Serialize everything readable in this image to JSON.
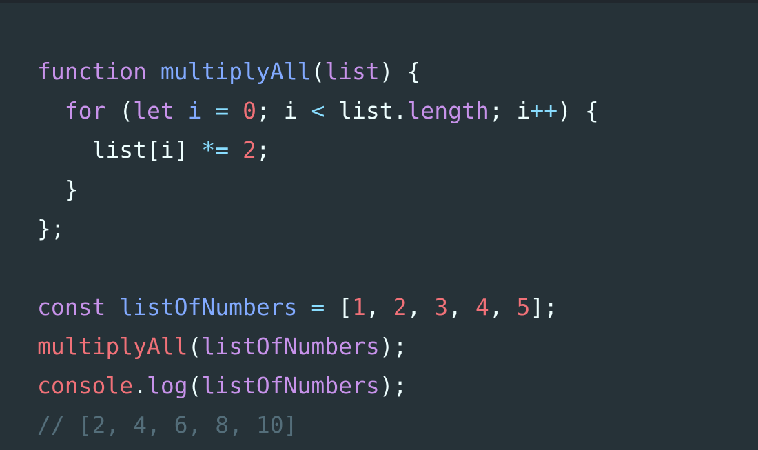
{
  "colors": {
    "background": "#263238",
    "default": "#eeffff",
    "keyword": "#c792ea",
    "function": "#82aaff",
    "number": "#f07178",
    "operator": "#89ddff",
    "comment": "#546e7a",
    "call": "#f07178",
    "punctuation": "#eeffff"
  },
  "code": {
    "lines": [
      {
        "tokens": [
          {
            "text": "function",
            "type": "keyword"
          },
          {
            "text": " ",
            "type": "default"
          },
          {
            "text": "multiplyAll",
            "type": "function"
          },
          {
            "text": "(",
            "type": "punctuation"
          },
          {
            "text": "list",
            "type": "keyword"
          },
          {
            "text": ") {",
            "type": "punctuation"
          }
        ]
      },
      {
        "tokens": [
          {
            "text": "  ",
            "type": "default"
          },
          {
            "text": "for",
            "type": "keyword"
          },
          {
            "text": " (",
            "type": "punctuation"
          },
          {
            "text": "let",
            "type": "keyword"
          },
          {
            "text": " ",
            "type": "default"
          },
          {
            "text": "i",
            "type": "function"
          },
          {
            "text": " ",
            "type": "default"
          },
          {
            "text": "=",
            "type": "operator"
          },
          {
            "text": " ",
            "type": "default"
          },
          {
            "text": "0",
            "type": "number"
          },
          {
            "text": "; i ",
            "type": "default"
          },
          {
            "text": "<",
            "type": "operator"
          },
          {
            "text": " list.",
            "type": "default"
          },
          {
            "text": "length",
            "type": "keyword"
          },
          {
            "text": "; i",
            "type": "default"
          },
          {
            "text": "++",
            "type": "operator"
          },
          {
            "text": ") {",
            "type": "punctuation"
          }
        ]
      },
      {
        "tokens": [
          {
            "text": "    list[i] ",
            "type": "default"
          },
          {
            "text": "*=",
            "type": "operator"
          },
          {
            "text": " ",
            "type": "default"
          },
          {
            "text": "2",
            "type": "number"
          },
          {
            "text": ";",
            "type": "punctuation"
          }
        ]
      },
      {
        "tokens": [
          {
            "text": "  }",
            "type": "punctuation"
          }
        ]
      },
      {
        "tokens": [
          {
            "text": "};",
            "type": "punctuation"
          }
        ]
      },
      {
        "tokens": []
      },
      {
        "tokens": [
          {
            "text": "const",
            "type": "keyword"
          },
          {
            "text": " ",
            "type": "default"
          },
          {
            "text": "listOfNumbers",
            "type": "function"
          },
          {
            "text": " ",
            "type": "default"
          },
          {
            "text": "=",
            "type": "operator"
          },
          {
            "text": " [",
            "type": "punctuation"
          },
          {
            "text": "1",
            "type": "number"
          },
          {
            "text": ", ",
            "type": "punctuation"
          },
          {
            "text": "2",
            "type": "number"
          },
          {
            "text": ", ",
            "type": "punctuation"
          },
          {
            "text": "3",
            "type": "number"
          },
          {
            "text": ", ",
            "type": "punctuation"
          },
          {
            "text": "4",
            "type": "number"
          },
          {
            "text": ", ",
            "type": "punctuation"
          },
          {
            "text": "5",
            "type": "number"
          },
          {
            "text": "];",
            "type": "punctuation"
          }
        ]
      },
      {
        "tokens": [
          {
            "text": "multiplyAll",
            "type": "call"
          },
          {
            "text": "(",
            "type": "punctuation"
          },
          {
            "text": "listOfNumbers",
            "type": "keyword"
          },
          {
            "text": ");",
            "type": "punctuation"
          }
        ]
      },
      {
        "tokens": [
          {
            "text": "console",
            "type": "call"
          },
          {
            "text": ".",
            "type": "punctuation"
          },
          {
            "text": "log",
            "type": "keyword"
          },
          {
            "text": "(",
            "type": "punctuation"
          },
          {
            "text": "listOfNumbers",
            "type": "keyword"
          },
          {
            "text": ");",
            "type": "punctuation"
          }
        ]
      },
      {
        "tokens": [
          {
            "text": "// [2, 4, 6, 8, 10]",
            "type": "comment"
          }
        ]
      }
    ]
  }
}
